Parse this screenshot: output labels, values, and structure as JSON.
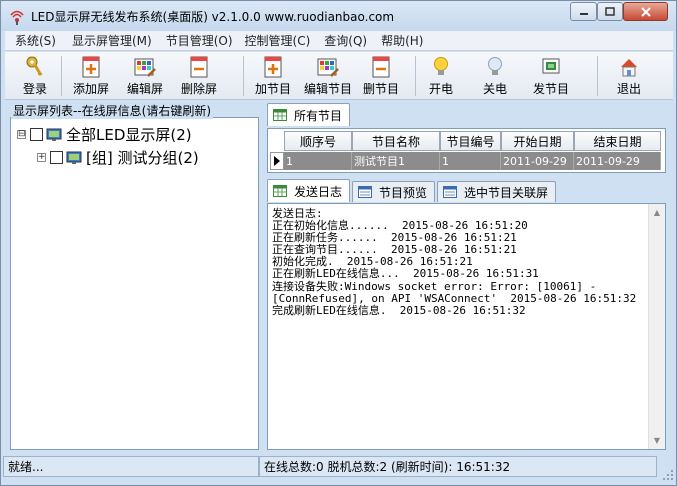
{
  "window": {
    "title": "LED显示屏无线发布系统(桌面版) v2.1.0.0  www.ruodianbao.com"
  },
  "menu": [
    "系统(S)",
    "显示屏管理(M)",
    "节目管理(O)",
    "控制管理(C)",
    "查询(Q)",
    "帮助(H)"
  ],
  "toolbar": {
    "login": "登录",
    "add_screen": "添加屏",
    "edit_screen": "编辑屏",
    "delete_screen": "删除屏",
    "add_program": "加节目",
    "edit_program": "编辑节目",
    "delete_program": "删节目",
    "power_on": "开电",
    "power_off": "关电",
    "publish_program": "发节目",
    "exit": "退出"
  },
  "screen_list": {
    "title": "显示屏列表--在线屏信息(请右键刷新)",
    "root": {
      "label": "全部LED显示屏(2)",
      "expander": "⊟"
    },
    "child": {
      "label": "[组] 测试分组(2)",
      "expander": "+"
    }
  },
  "programs": {
    "tab": "所有节目",
    "columns": [
      "顺序号",
      "节目名称",
      "节目编号",
      "开始日期",
      "结束日期"
    ],
    "rows": [
      {
        "seq": "1",
        "name": "测试节目1",
        "number": "1",
        "start": "2011-09-29",
        "end": "2011-09-29"
      }
    ]
  },
  "bottom_tabs": [
    "发送日志",
    "节目预览",
    "选中节目关联屏"
  ],
  "log": {
    "text": "发送日志:\n正在初始化信息......  2015-08-26 16:51:20\n正在刷新任务......  2015-08-26 16:51:21\n正在查询节目......  2015-08-26 16:51:21\n初始化完成.  2015-08-26 16:51:21\n正在刷新LED在线信息...  2015-08-26 16:51:31\n连接设备失败:Windows socket error: Error: [10061] - [ConnRefused], on API 'WSAConnect'  2015-08-26 16:51:32\n完成刷新LED在线信息.  2015-08-26 16:51:32"
  },
  "status": {
    "ready": "就绪...",
    "online": "在线总数:0  脱机总数:2 (刷新时间): 16:51:32"
  },
  "colors": {
    "window_bg": "#cfe0f3",
    "selected_row": "#8c8c8c",
    "close_button": "#c74a34"
  }
}
